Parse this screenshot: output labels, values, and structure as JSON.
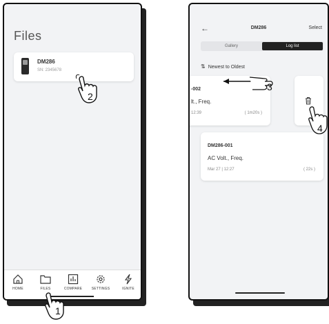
{
  "screen1": {
    "title": "Files",
    "device": {
      "name": "DM286",
      "serial": "SN: 2345678"
    },
    "nav": [
      {
        "label": "HOME",
        "icon": "home-icon"
      },
      {
        "label": "FILES",
        "icon": "folder-icon"
      },
      {
        "label": "COMPARE",
        "icon": "bar-chart-icon"
      },
      {
        "label": "SETTINGS",
        "icon": "gear-icon"
      },
      {
        "label": "IGNITE",
        "icon": "lightning-icon"
      }
    ]
  },
  "screen2": {
    "back_icon": "back-arrow-icon",
    "title": "DM286",
    "select": "Select",
    "tabs": {
      "gallery": "Gallery",
      "log_list": "Log list",
      "active": "log_list"
    },
    "sort_label": "Newest to Oldest",
    "logs": [
      {
        "name": "-002",
        "type": "lt., Freq.",
        "date": "12:39",
        "duration": "( 1m20s )"
      },
      {
        "name": "DM286-001",
        "type": "AC Volt., Freq.",
        "date": "Mar 27 | 12:27",
        "duration": "( 22s )"
      }
    ],
    "delete_icon": "trash-icon"
  },
  "annotations": {
    "step1": "1",
    "step2": "2",
    "step3": "3",
    "step4": "4"
  }
}
